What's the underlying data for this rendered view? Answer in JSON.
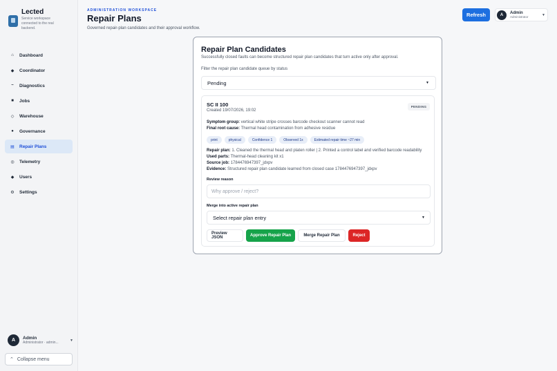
{
  "sidebar": {
    "brand_name": "Lected",
    "brand_sub": "Service workspace connected to the real backend.",
    "items": [
      {
        "label": "Dashboard",
        "icon": "home-icon"
      },
      {
        "label": "Coordinator",
        "icon": "diamond-icon"
      },
      {
        "label": "Diagnostics",
        "icon": "pulse-icon"
      },
      {
        "label": "Jobs",
        "icon": "briefcase-icon"
      },
      {
        "label": "Warehouse",
        "icon": "box-icon"
      },
      {
        "label": "Governance",
        "icon": "person-icon"
      },
      {
        "label": "Repair Plans",
        "icon": "list-icon"
      },
      {
        "label": "Telemetry",
        "icon": "gauge-icon"
      },
      {
        "label": "Users",
        "icon": "users-icon"
      },
      {
        "label": "Settings",
        "icon": "gear-icon"
      }
    ],
    "active_item": "Repair Plans",
    "user": {
      "initial": "A",
      "name": "Admin",
      "role": "Administrator · admin..."
    },
    "collapse_label": "Collapse menu"
  },
  "header": {
    "eyebrow": "ADMINISTRATION WORKSPACE",
    "title": "Repair Plans",
    "subtitle": "Governed repair-plan candidates and their approval workflow.",
    "refresh_label": "Refresh",
    "user": {
      "initial": "A",
      "name": "Admin",
      "role": "Administrator"
    }
  },
  "card": {
    "title": "Repair Plan Candidates",
    "subtitle": "Successfully closed faults can become structured repair plan candidates that turn active only after approval.",
    "filter_label": "Filter the repair plan candidate queue by status",
    "filter_value": "Pending",
    "candidate": {
      "title": "SC II 100",
      "created": "Created 19/07/2026, 19:02",
      "status": "PENDING",
      "symptom_label": "Symptom group:",
      "symptom_value": "vertical white stripe crosses barcode checkout scanner cannot read",
      "root_label": "Final root cause:",
      "root_value": "Thermal head contamination from adhesive residue",
      "tags": [
        "print",
        "physical",
        "Confidence 1",
        "Observed 1x",
        "Estimated repair time ~27 min"
      ],
      "plan_label": "Repair plan:",
      "plan_value": "1. Cleaned the thermal head and platen roller | 2. Printed a control label and verified barcode readability",
      "parts_label": "Used parts:",
      "parts_value": "Thermal-head cleaning kit x1",
      "job_label": "Source job:",
      "job_value": "1784476947397_jdxpv",
      "evidence_label": "Evidence:",
      "evidence_value": "Structured repair plan candidate learned from closed case 1784476947397_jdxpv",
      "review_label": "Review reason",
      "review_placeholder": "Why approve / reject?",
      "merge_label": "Merge into active repair plan",
      "merge_value": "Select repair plan entry",
      "buttons": {
        "preview": "Preview JSON",
        "approve": "Approve Repair Plan",
        "merge": "Merge Repair Plan",
        "reject": "Reject"
      }
    }
  },
  "colors": {
    "accent": "#1d6fe0",
    "approve": "#16a34a",
    "reject": "#dc2626",
    "active_nav_bg": "#dce8f7"
  }
}
